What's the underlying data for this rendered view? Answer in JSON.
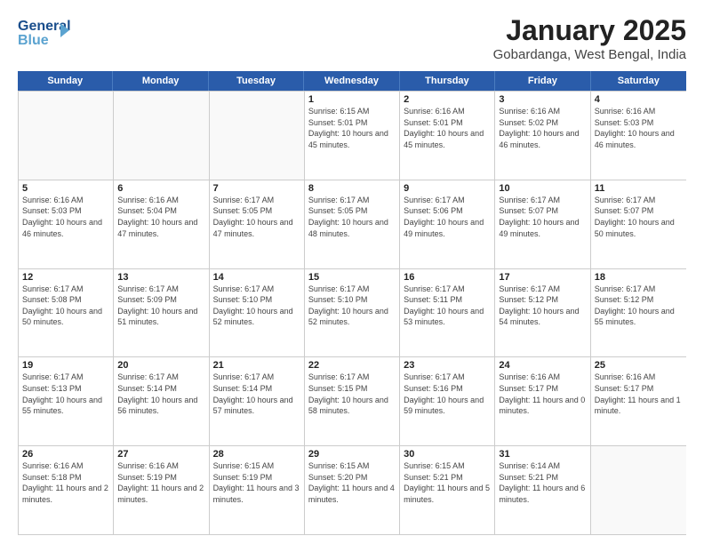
{
  "logo": {
    "line1": "General",
    "line2": "Blue"
  },
  "title": "January 2025",
  "subtitle": "Gobardanga, West Bengal, India",
  "weekdays": [
    "Sunday",
    "Monday",
    "Tuesday",
    "Wednesday",
    "Thursday",
    "Friday",
    "Saturday"
  ],
  "weeks": [
    [
      {
        "day": "",
        "empty": true
      },
      {
        "day": "",
        "empty": true
      },
      {
        "day": "",
        "empty": true
      },
      {
        "day": "1",
        "sunrise": "6:15 AM",
        "sunset": "5:01 PM",
        "daylight": "10 hours and 45 minutes."
      },
      {
        "day": "2",
        "sunrise": "6:16 AM",
        "sunset": "5:01 PM",
        "daylight": "10 hours and 45 minutes."
      },
      {
        "day": "3",
        "sunrise": "6:16 AM",
        "sunset": "5:02 PM",
        "daylight": "10 hours and 46 minutes."
      },
      {
        "day": "4",
        "sunrise": "6:16 AM",
        "sunset": "5:03 PM",
        "daylight": "10 hours and 46 minutes."
      }
    ],
    [
      {
        "day": "5",
        "sunrise": "6:16 AM",
        "sunset": "5:03 PM",
        "daylight": "10 hours and 46 minutes."
      },
      {
        "day": "6",
        "sunrise": "6:16 AM",
        "sunset": "5:04 PM",
        "daylight": "10 hours and 47 minutes."
      },
      {
        "day": "7",
        "sunrise": "6:17 AM",
        "sunset": "5:05 PM",
        "daylight": "10 hours and 47 minutes."
      },
      {
        "day": "8",
        "sunrise": "6:17 AM",
        "sunset": "5:05 PM",
        "daylight": "10 hours and 48 minutes."
      },
      {
        "day": "9",
        "sunrise": "6:17 AM",
        "sunset": "5:06 PM",
        "daylight": "10 hours and 49 minutes."
      },
      {
        "day": "10",
        "sunrise": "6:17 AM",
        "sunset": "5:07 PM",
        "daylight": "10 hours and 49 minutes."
      },
      {
        "day": "11",
        "sunrise": "6:17 AM",
        "sunset": "5:07 PM",
        "daylight": "10 hours and 50 minutes."
      }
    ],
    [
      {
        "day": "12",
        "sunrise": "6:17 AM",
        "sunset": "5:08 PM",
        "daylight": "10 hours and 50 minutes."
      },
      {
        "day": "13",
        "sunrise": "6:17 AM",
        "sunset": "5:09 PM",
        "daylight": "10 hours and 51 minutes."
      },
      {
        "day": "14",
        "sunrise": "6:17 AM",
        "sunset": "5:10 PM",
        "daylight": "10 hours and 52 minutes."
      },
      {
        "day": "15",
        "sunrise": "6:17 AM",
        "sunset": "5:10 PM",
        "daylight": "10 hours and 52 minutes."
      },
      {
        "day": "16",
        "sunrise": "6:17 AM",
        "sunset": "5:11 PM",
        "daylight": "10 hours and 53 minutes."
      },
      {
        "day": "17",
        "sunrise": "6:17 AM",
        "sunset": "5:12 PM",
        "daylight": "10 hours and 54 minutes."
      },
      {
        "day": "18",
        "sunrise": "6:17 AM",
        "sunset": "5:12 PM",
        "daylight": "10 hours and 55 minutes."
      }
    ],
    [
      {
        "day": "19",
        "sunrise": "6:17 AM",
        "sunset": "5:13 PM",
        "daylight": "10 hours and 55 minutes."
      },
      {
        "day": "20",
        "sunrise": "6:17 AM",
        "sunset": "5:14 PM",
        "daylight": "10 hours and 56 minutes."
      },
      {
        "day": "21",
        "sunrise": "6:17 AM",
        "sunset": "5:14 PM",
        "daylight": "10 hours and 57 minutes."
      },
      {
        "day": "22",
        "sunrise": "6:17 AM",
        "sunset": "5:15 PM",
        "daylight": "10 hours and 58 minutes."
      },
      {
        "day": "23",
        "sunrise": "6:17 AM",
        "sunset": "5:16 PM",
        "daylight": "10 hours and 59 minutes."
      },
      {
        "day": "24",
        "sunrise": "6:16 AM",
        "sunset": "5:17 PM",
        "daylight": "11 hours and 0 minutes."
      },
      {
        "day": "25",
        "sunrise": "6:16 AM",
        "sunset": "5:17 PM",
        "daylight": "11 hours and 1 minute."
      }
    ],
    [
      {
        "day": "26",
        "sunrise": "6:16 AM",
        "sunset": "5:18 PM",
        "daylight": "11 hours and 2 minutes."
      },
      {
        "day": "27",
        "sunrise": "6:16 AM",
        "sunset": "5:19 PM",
        "daylight": "11 hours and 2 minutes."
      },
      {
        "day": "28",
        "sunrise": "6:15 AM",
        "sunset": "5:19 PM",
        "daylight": "11 hours and 3 minutes."
      },
      {
        "day": "29",
        "sunrise": "6:15 AM",
        "sunset": "5:20 PM",
        "daylight": "11 hours and 4 minutes."
      },
      {
        "day": "30",
        "sunrise": "6:15 AM",
        "sunset": "5:21 PM",
        "daylight": "11 hours and 5 minutes."
      },
      {
        "day": "31",
        "sunrise": "6:14 AM",
        "sunset": "5:21 PM",
        "daylight": "11 hours and 6 minutes."
      },
      {
        "day": "",
        "empty": true
      }
    ]
  ]
}
